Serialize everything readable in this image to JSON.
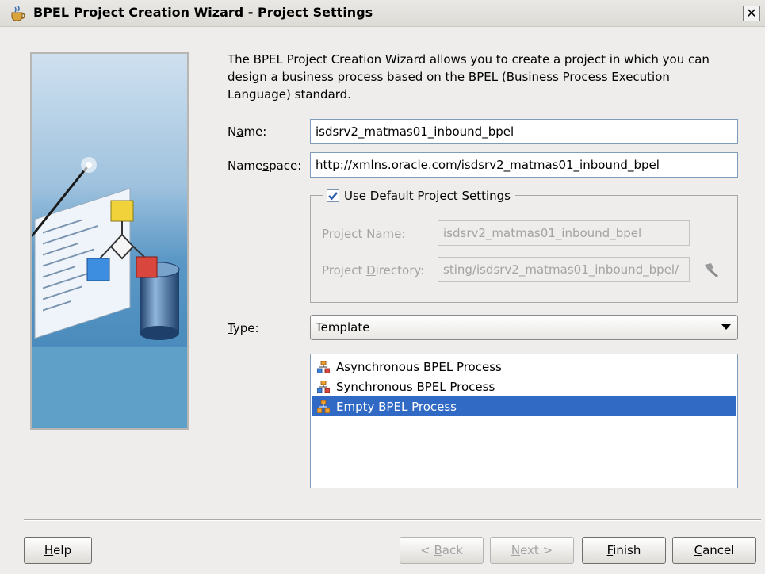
{
  "window": {
    "title": "BPEL Project Creation Wizard - Project Settings",
    "close_glyph": "✕",
    "title_icon": "coffee-cup-icon"
  },
  "intro_text": "The BPEL Project Creation Wizard allows you to create a project in which you can design a business process based on the BPEL (Business Process Execution Language) standard.",
  "name": {
    "label_pre": "N",
    "label_mnemonic": "a",
    "label_post": "me:",
    "value": "isdsrv2_matmas01_inbound_bpel"
  },
  "namespace": {
    "label_pre": "Name",
    "label_mnemonic": "s",
    "label_post": "pace:",
    "value": "http://xmlns.oracle.com/isdsrv2_matmas01_inbound_bpel"
  },
  "default_settings": {
    "checked": true,
    "label_mnemonic": "U",
    "label_post": "se Default Project Settings",
    "project_name": {
      "label_mnemonic": "P",
      "label_post": "roject Name:",
      "value": "isdsrv2_matmas01_inbound_bpel"
    },
    "project_directory": {
      "label_pre": "Project ",
      "label_mnemonic": "D",
      "label_post": "irectory:",
      "value": "sting/isdsrv2_matmas01_inbound_bpel/"
    },
    "browse_icon": "flashlight-browse-icon"
  },
  "type": {
    "label_mnemonic": "T",
    "label_post": "ype:",
    "selected": "Template"
  },
  "templates": [
    {
      "label": "Asynchronous BPEL Process",
      "selected": false
    },
    {
      "label": "Synchronous BPEL Process",
      "selected": false
    },
    {
      "label": "Empty BPEL Process",
      "selected": true
    }
  ],
  "buttons": {
    "help": {
      "mnemonic": "H",
      "rest": "elp"
    },
    "back": {
      "pre": "< ",
      "mnemonic": "B",
      "rest": "ack",
      "enabled": false
    },
    "next": {
      "pre": "",
      "mnemonic": "N",
      "rest": "ext >",
      "enabled": false
    },
    "finish": {
      "mnemonic": "F",
      "rest": "inish"
    },
    "cancel": {
      "mnemonic": "C",
      "rest": "ancel"
    }
  },
  "colors": {
    "selection": "#316ac5",
    "checkmark": "#2b5fad",
    "image_bg": "#2f79a9"
  }
}
